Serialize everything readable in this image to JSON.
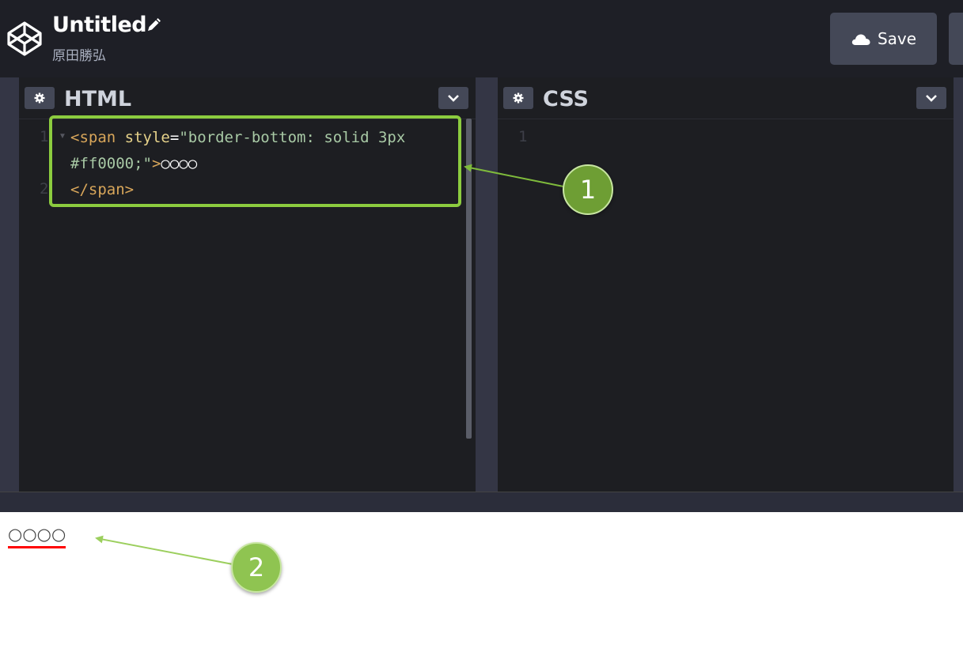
{
  "header": {
    "title": "Untitled",
    "author": "原田勝弘",
    "save_label": "Save"
  },
  "html_pane": {
    "title": "HTML",
    "line_numbers": [
      "1",
      "2"
    ],
    "code": {
      "tag_open": "<span",
      "attr_name": "style",
      "equals": "=",
      "attr_value_1": "\"border-bottom: solid 3px",
      "attr_value_2": "#ff0000;\"",
      "tag_close": ">",
      "text": "○○○○",
      "end_tag": "</span>"
    }
  },
  "css_pane": {
    "title": "CSS",
    "line_numbers": [
      "1"
    ]
  },
  "result": {
    "text": "○○○○"
  },
  "callouts": [
    "1",
    "2"
  ],
  "colors": {
    "highlight_border": "#8ccc3f",
    "underline": "#ff0000",
    "callout_1": "#6e9e34",
    "callout_2": "#8fc451"
  }
}
